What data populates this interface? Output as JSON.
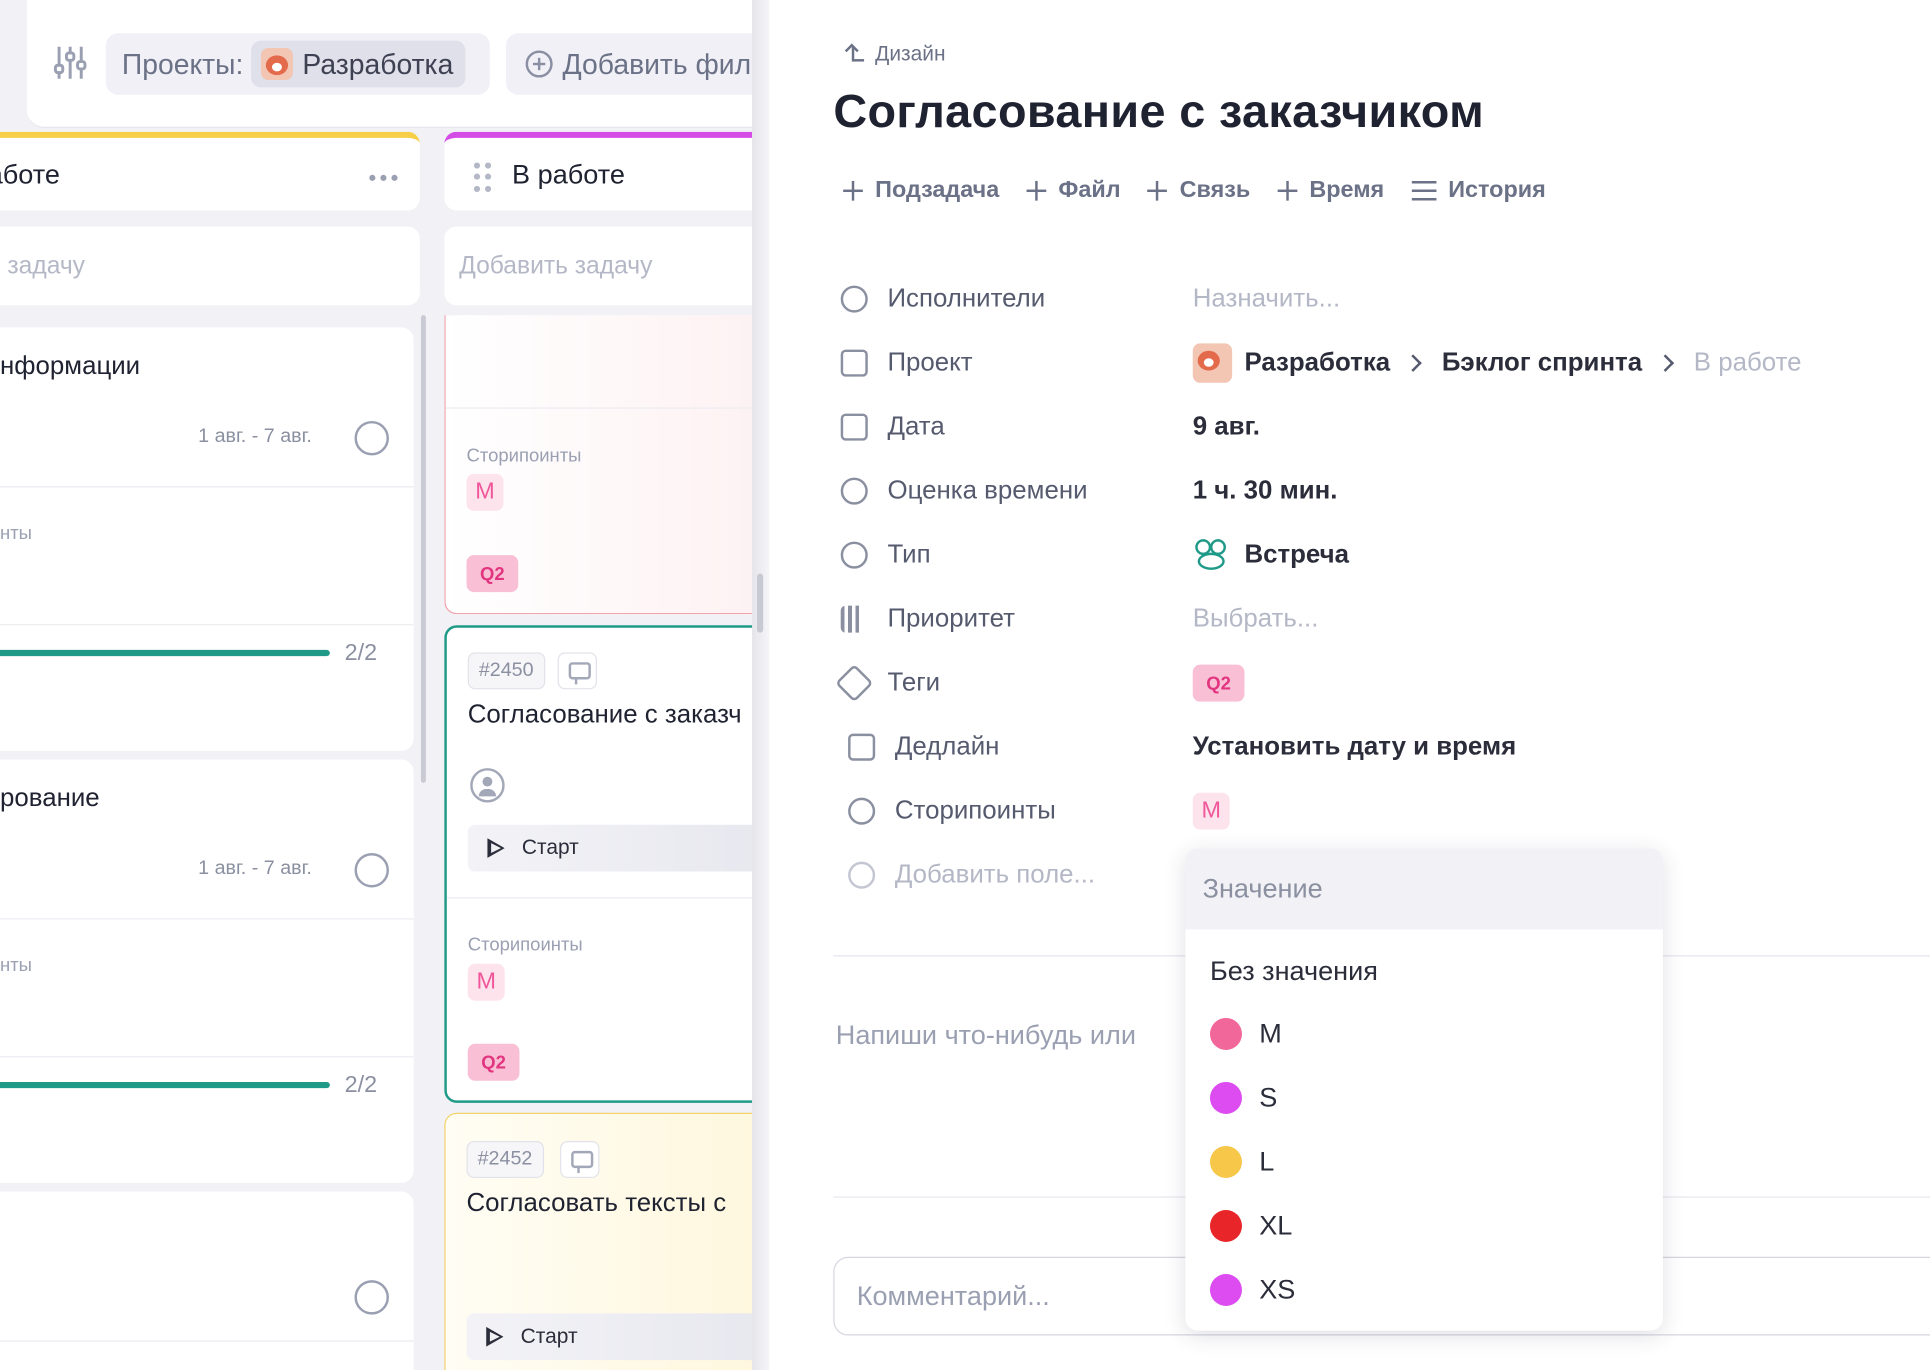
{
  "filter": {
    "projects_label": "Проекты:",
    "project_value": "Разработка",
    "add_filter_label": "Добавить фил"
  },
  "columns": [
    {
      "title": "аботе",
      "add_task_placeholder": "ь задачу",
      "accent": "#f6cf47",
      "cards": [
        {
          "title": "нформации",
          "dates": "1 авг. - 7 авг.",
          "storypoints_label": "нты",
          "progress": "2/2"
        },
        {
          "title": "рование",
          "dates": "1 авг. - 7 авг.",
          "storypoints_label": "нты",
          "progress": "2/2"
        }
      ]
    },
    {
      "title": "В работе",
      "add_task_placeholder": "Добавить задачу",
      "accent": "#d54be6",
      "cards": [
        {
          "storypoints_label": "Сторипоинты",
          "size": "M",
          "tag": "Q2"
        },
        {
          "id": "#2450",
          "title": "Согласование с заказч",
          "start": "Старт",
          "storypoints_label": "Сторипоинты",
          "size": "M",
          "tag": "Q2"
        },
        {
          "id": "#2452",
          "title": "Согласовать тексты с",
          "start": "Старт"
        }
      ]
    }
  ],
  "panel": {
    "breadcrumb": "Дизайн",
    "title": "Согласование с заказчиком",
    "actions": [
      {
        "label": "Подзадача",
        "icon": "plus-icon"
      },
      {
        "label": "Файл",
        "icon": "plus-icon"
      },
      {
        "label": "Связь",
        "icon": "plus-icon"
      },
      {
        "label": "Время",
        "icon": "plus-icon"
      },
      {
        "label": "История",
        "icon": "list-icon"
      }
    ],
    "fields": {
      "assignees": {
        "label": "Исполнители",
        "value": "Назначить..."
      },
      "project": {
        "label": "Проект",
        "path": [
          "Разработка",
          "Бэклог спринта",
          "В работе"
        ]
      },
      "date": {
        "label": "Дата",
        "value": "9 авг."
      },
      "estimate": {
        "label": "Оценка времени",
        "value": "1 ч. 30 мин."
      },
      "type": {
        "label": "Тип",
        "value": "Встреча"
      },
      "priority": {
        "label": "Приоритет",
        "value": "Выбрать..."
      },
      "tags": {
        "label": "Теги",
        "value": "Q2"
      },
      "deadline": {
        "label": "Дедлайн",
        "value": "Установить дату и время"
      },
      "storypoints": {
        "label": "Сторипоинты",
        "value": "M"
      },
      "add_field": {
        "label": "Добавить поле..."
      }
    },
    "description_placeholder": "Напиши что-нибудь или",
    "comment_placeholder": "Комментарий..."
  },
  "dropdown": {
    "search_placeholder": "Значение",
    "none_option": "Без значения",
    "options": [
      {
        "label": "M",
        "color": "#f2679a"
      },
      {
        "label": "S",
        "color": "#dc4cf0"
      },
      {
        "label": "L",
        "color": "#f7c74a"
      },
      {
        "label": "XL",
        "color": "#e8262a"
      },
      {
        "label": "XS",
        "color": "#dc4cf0"
      }
    ]
  }
}
